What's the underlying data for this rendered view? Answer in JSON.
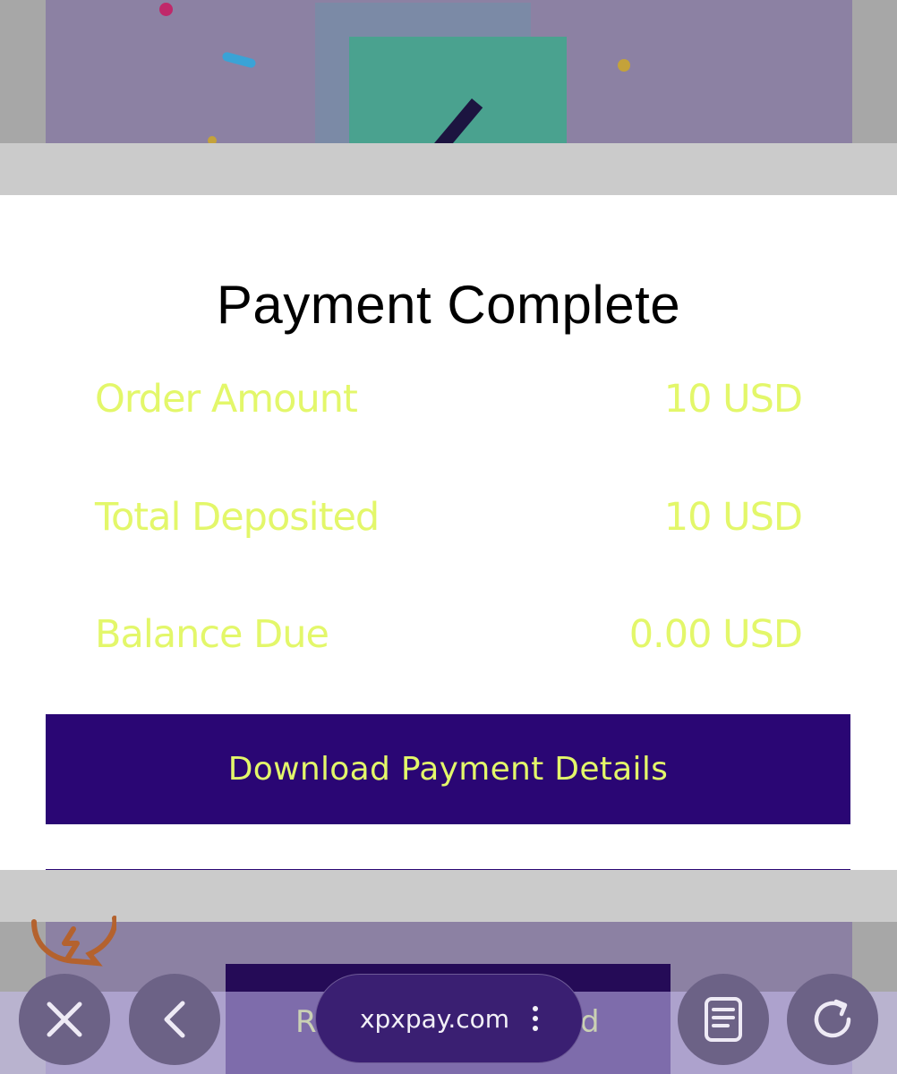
{
  "modal": {
    "title": "Payment Complete",
    "rows": [
      {
        "label": "Order Amount",
        "value": "10 USD"
      },
      {
        "label": "Total Deposited",
        "value": "10 USD"
      },
      {
        "label": "Balance Due",
        "value": "0.00 USD"
      }
    ],
    "download_label": "Download Payment Details"
  },
  "background": {
    "lower_button_left": "R",
    "lower_button_right": "d"
  },
  "browser": {
    "url": "xpxpay.com",
    "close_icon": "close-icon",
    "back_icon": "chevron-left-icon",
    "reader_icon": "reader-icon",
    "reload_icon": "reload-icon"
  },
  "colors": {
    "accent_text": "#e3f76a",
    "button_bg": "#2a0674"
  }
}
